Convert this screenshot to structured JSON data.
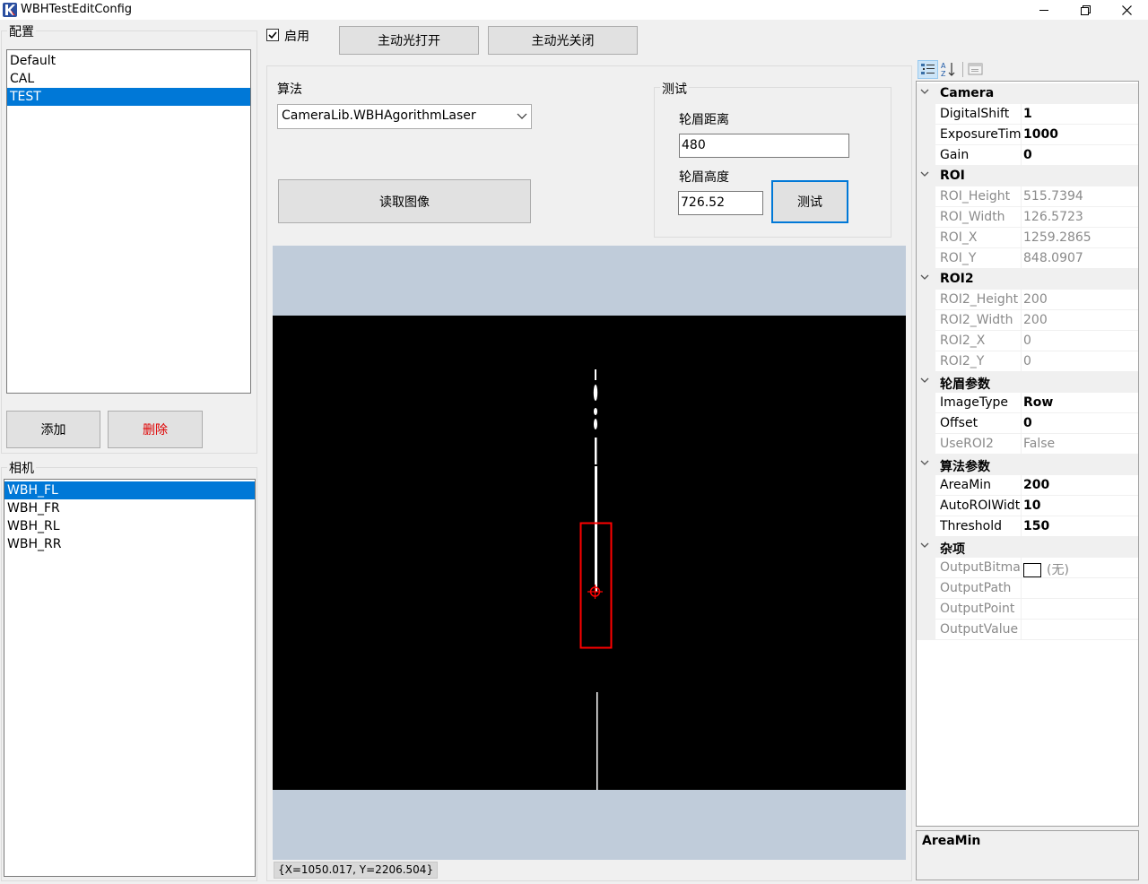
{
  "window": {
    "title": "WBHTestEditConfig"
  },
  "config": {
    "label": "配置",
    "items": [
      "Default",
      "CAL",
      "TEST"
    ],
    "selected_index": 2,
    "add_label": "添加",
    "delete_label": "删除"
  },
  "camera": {
    "label": "相机",
    "items": [
      "WBH_FL",
      "WBH_FR",
      "WBH_RL",
      "WBH_RR"
    ],
    "selected_index": 0
  },
  "toolbar": {
    "enable_label": "启用",
    "enable_checked": true,
    "light_on_label": "主动光打开",
    "light_off_label": "主动光关闭"
  },
  "algorithm": {
    "label": "算法",
    "selected": "CameraLib.WBHAgorithmLaser",
    "read_image_label": "读取图像"
  },
  "test": {
    "label": "测试",
    "distance_label": "轮眉距离",
    "distance_value": "480",
    "height_label": "轮眉高度",
    "height_value": "726.52",
    "test_button_label": "测试"
  },
  "viewer": {
    "status": "{X=1050.017, Y=2206.504}"
  },
  "property_grid": {
    "categories": [
      {
        "name": "Camera",
        "props": [
          {
            "name": "DigitalShift",
            "value": "1",
            "readonly": false
          },
          {
            "name": "ExposureTime",
            "value": "1000",
            "readonly": false
          },
          {
            "name": "Gain",
            "value": "0",
            "readonly": false
          }
        ]
      },
      {
        "name": "ROI",
        "props": [
          {
            "name": "ROI_Height",
            "value": "515.7394",
            "readonly": true
          },
          {
            "name": "ROI_Width",
            "value": "126.5723",
            "readonly": true
          },
          {
            "name": "ROI_X",
            "value": "1259.2865",
            "readonly": true
          },
          {
            "name": "ROI_Y",
            "value": "848.0907",
            "readonly": true
          }
        ]
      },
      {
        "name": "ROI2",
        "props": [
          {
            "name": "ROI2_Height",
            "value": "200",
            "readonly": true
          },
          {
            "name": "ROI2_Width",
            "value": "200",
            "readonly": true
          },
          {
            "name": "ROI2_X",
            "value": "0",
            "readonly": true
          },
          {
            "name": "ROI2_Y",
            "value": "0",
            "readonly": true
          }
        ]
      },
      {
        "name": "轮眉参数",
        "props": [
          {
            "name": "ImageType",
            "value": "Row",
            "readonly": false
          },
          {
            "name": "Offset",
            "value": "0",
            "readonly": false
          },
          {
            "name": "UseROI2",
            "value": "False",
            "readonly": true
          }
        ]
      },
      {
        "name": "算法参数",
        "props": [
          {
            "name": "AreaMin",
            "value": "200",
            "readonly": false
          },
          {
            "name": "AutoROIWidth",
            "value": "10",
            "readonly": false
          },
          {
            "name": "Threshold",
            "value": "150",
            "readonly": false
          }
        ]
      },
      {
        "name": "杂项",
        "props": [
          {
            "name": "OutputBitmap",
            "value": "(无)",
            "readonly": true,
            "swatch": true
          },
          {
            "name": "OutputPath",
            "value": "",
            "readonly": true
          },
          {
            "name": "OutputPoint",
            "value": "",
            "readonly": true
          },
          {
            "name": "OutputValue",
            "value": "",
            "readonly": true
          }
        ]
      }
    ],
    "description_title": "AreaMin"
  },
  "colors": {
    "selection": "#0078d7",
    "delete_text": "#e00000",
    "roi_box": "#ff0000",
    "viewer_bg": "#c0ccda"
  }
}
